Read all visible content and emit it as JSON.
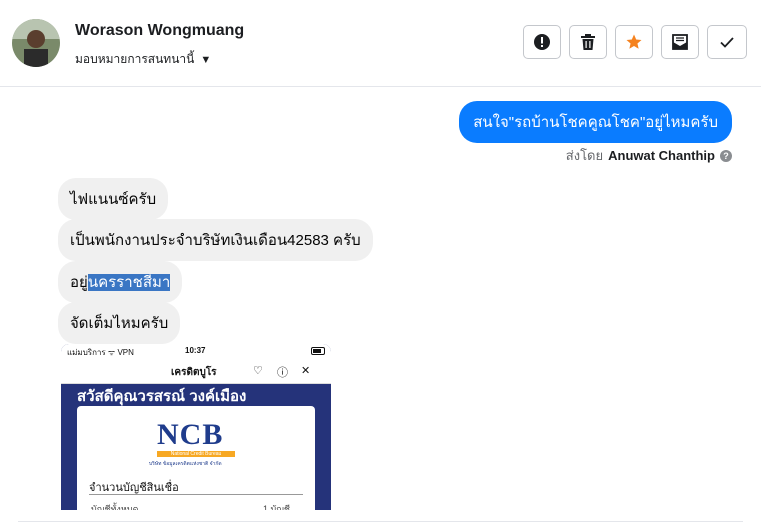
{
  "header": {
    "name": "Worason Wongmuang",
    "assign_label": "มอบหมายการสนทนานี้",
    "actions": [
      "report",
      "delete",
      "star",
      "mark-unread",
      "done"
    ],
    "star_color": "#f5821f"
  },
  "messages": {
    "outgoing": {
      "text": "สนใจ\"รถบ้านโชคคูณโชค\"อยู่ไหมครับ",
      "sent_by_label": "ส่งโดย",
      "sent_by_name": "Anuwat Chanthip",
      "help_glyph": "?",
      "bubble_color": "#0a7cff"
    },
    "incoming": [
      {
        "text": "ไฟแนนซ์ครับ"
      },
      {
        "text": "เป็นพนักงานประจำบริษัทเงินเดือน42583 ครับ"
      },
      {
        "text_before": "อยู่",
        "text_highlight": "นครราชสีมา"
      },
      {
        "text": "จัดเต็มไหมครับ"
      }
    ]
  },
  "attachment": {
    "status_left": "แม่มบริการ ᯤ VPN",
    "status_time": "10:37",
    "app_title": "เครดิตบูโร",
    "greeting": "สวัสดีคุณวรสรณ์ วงค์เมือง",
    "logo_text": "NCB",
    "logo_sub": "National Credit Bureau",
    "logo_sub2": "บริษัท ข้อมูลเครดิตแห่งชาติ จำกัด",
    "section_title": "จำนวนบัญชีสินเชื่อ",
    "row_label": "บัญชีทั้งหมด",
    "row_value": "1    บัญชี"
  }
}
